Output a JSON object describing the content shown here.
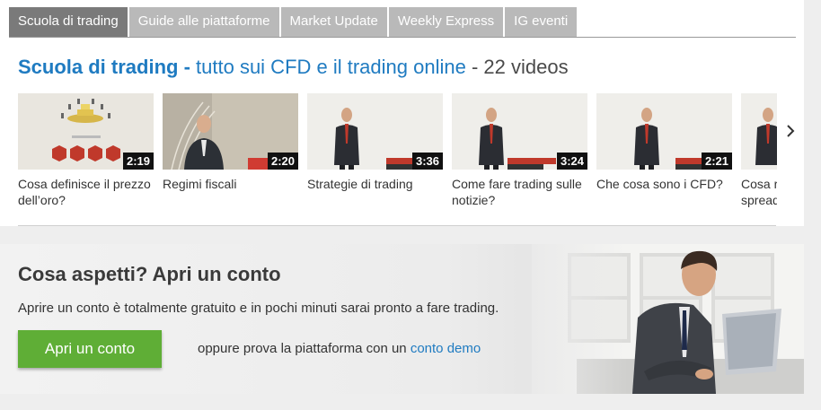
{
  "tabs": [
    {
      "label": "Scuola di trading",
      "active": true
    },
    {
      "label": "Guide alle piattaforme",
      "active": false
    },
    {
      "label": "Market Update",
      "active": false
    },
    {
      "label": "Weekly Express",
      "active": false
    },
    {
      "label": "IG eventi",
      "active": false
    }
  ],
  "heading": {
    "main": "Scuola di trading",
    "separator": " - ",
    "sub": "tutto sui CFD e il trading online",
    "count_text": " - 22 videos"
  },
  "videos": [
    {
      "title": "Cosa definisce il prezzo dell’oro?",
      "duration": "2:19",
      "scene": "gold-animation"
    },
    {
      "title": "Regimi fiscali",
      "duration": "2:20",
      "scene": "presenter-office"
    },
    {
      "title": "Strategie di trading",
      "duration": "3:36",
      "scene": "presenter-studio"
    },
    {
      "title": "Come fare trading sulle notizie?",
      "duration": "3:24",
      "scene": "presenter-studio"
    },
    {
      "title": "Che cosa sono i CFD?",
      "duration": "2:21",
      "scene": "presenter-studio"
    },
    {
      "title": "Cosa rappresenta lo spread?",
      "duration": "",
      "scene": "presenter-studio"
    }
  ],
  "banner": {
    "title": "Cosa aspetti? Apri un conto",
    "text": "Aprire un conto è totalmente gratuito e in pochi minuti sarai pronto a fare trading.",
    "cta_label": "Apri un conto",
    "alt_prefix": "oppure prova la piattaforma con un ",
    "alt_link": "conto demo"
  },
  "icons": {
    "next": "chevron-right-icon"
  },
  "colors": {
    "accent_blue": "#1f7bc1",
    "tab_active": "#7a7a7a",
    "tab_inactive": "#b9b9b9",
    "cta_green": "#5fae36"
  }
}
